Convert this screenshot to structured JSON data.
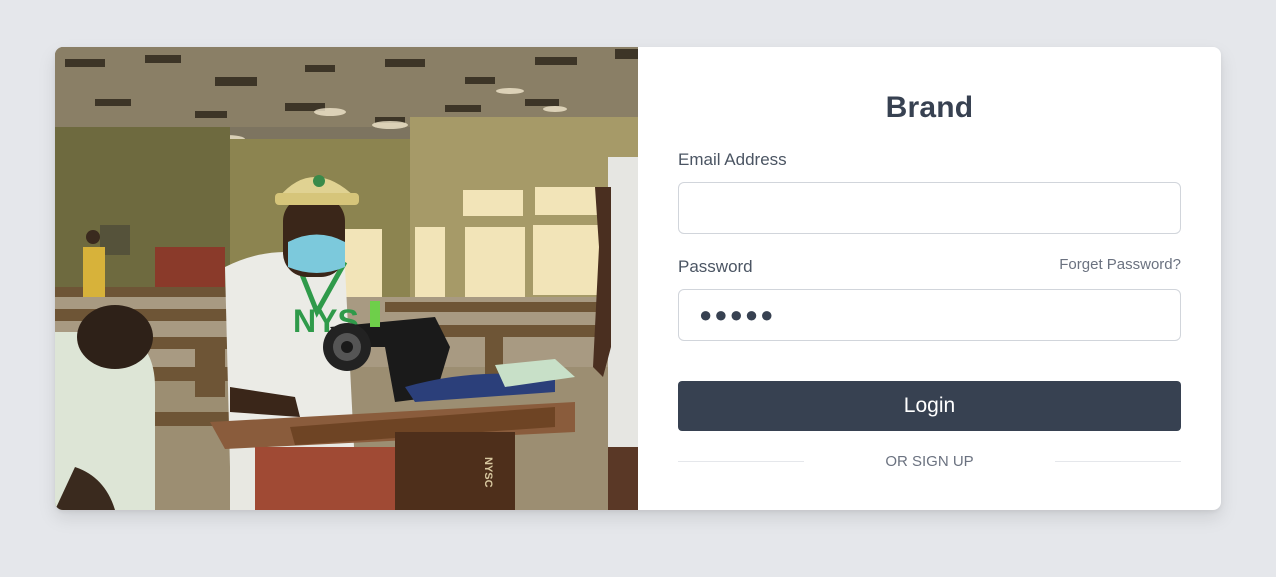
{
  "image": {
    "description_icon": "photo-of-tailor-at-sewing-machine"
  },
  "form": {
    "brand": "Brand",
    "email_label": "Email Address",
    "email_value": "",
    "password_label": "Password",
    "forgot_label": "Forget Password?",
    "password_value": "●●●●●",
    "login_label": "Login",
    "signup_label": "OR SIGN UP"
  },
  "colors": {
    "page_bg": "#e5e7eb",
    "card_bg": "#ffffff",
    "button_bg": "#374151",
    "text_dark": "#374151",
    "text_muted": "#6b7280"
  }
}
